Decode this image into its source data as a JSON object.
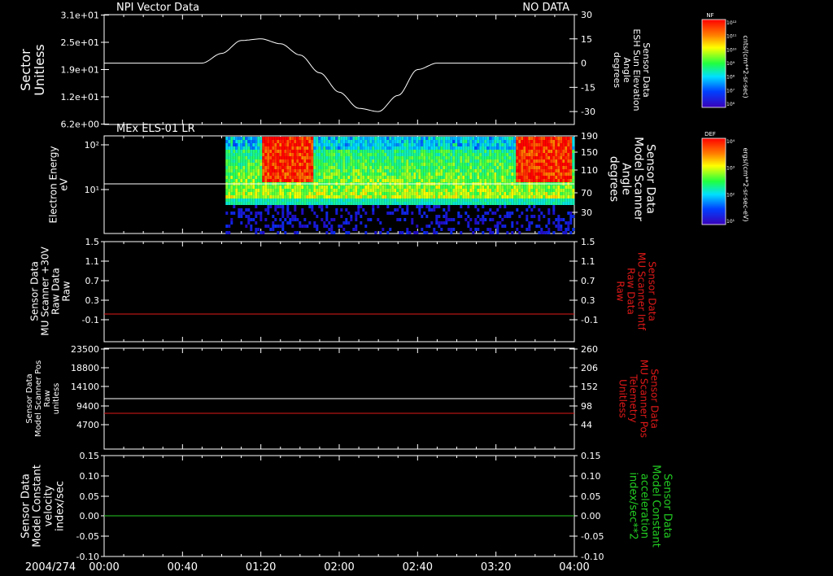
{
  "date_label": "2004/274",
  "x_ticks": [
    "00:00",
    "00:40",
    "01:20",
    "02:00",
    "02:40",
    "03:20",
    "04:00"
  ],
  "panels": [
    {
      "title": "NPI Vector Data",
      "status": "NO DATA",
      "left_label": [
        "Sector",
        "Unitless"
      ],
      "left_ticks": [
        "3.1e+01",
        "2.5e+01",
        "1.9e+01",
        "1.2e+01",
        "6.2e+00"
      ],
      "right_label": [
        "Sensor Data",
        "ESH Sun Elevation",
        "Angle",
        "degrees"
      ],
      "right_ticks": [
        "30",
        "15",
        "0",
        "-15",
        "-30"
      ],
      "colorbar": {
        "title": "NF",
        "ticks": [
          "10¹²",
          "10¹¹",
          "10¹⁰",
          "10⁹",
          "10⁸",
          "10⁷",
          "10⁶"
        ],
        "unit": "cnts/(cm**2-sr-sec)"
      }
    },
    {
      "title": "MEx ELS-01 LR",
      "left_label": [
        "Electron Energy",
        "eV"
      ],
      "left_ticks": [
        "10²",
        "10¹"
      ],
      "right_label": [
        "Sensor Data",
        "Model Scanner",
        "Angle",
        "degrees"
      ],
      "right_ticks": [
        "190",
        "150",
        "110",
        "70",
        "30"
      ],
      "colorbar": {
        "title": "DEF",
        "ticks": [
          "10⁴",
          "10³",
          "10²",
          "10¹"
        ],
        "unit": "ergs/(cm**2-sr-sec-eV)"
      }
    },
    {
      "left_label": [
        "Sensor Data",
        "MU Scanner +30V",
        "Raw Data",
        "Raw"
      ],
      "left_ticks": [
        "1.5",
        "1.1",
        "0.7",
        "0.3",
        "-0.1"
      ],
      "right_label": [
        "Sensor Data",
        "MU Scanner Intf",
        "Raw Data",
        "Raw"
      ],
      "right_ticks": [
        "1.5",
        "1.1",
        "0.7",
        "0.3",
        "-0.1"
      ]
    },
    {
      "left_label": [
        "Sensor Data",
        "Model Scanner Pos",
        "Raw",
        "unitless"
      ],
      "left_ticks": [
        "23500",
        "18800",
        "14100",
        "9400",
        "4700"
      ],
      "right_label": [
        "Sensor Data",
        "MU Scanner Pos",
        "Telemetry",
        "Unitless"
      ],
      "right_ticks": [
        "260",
        "206",
        "152",
        "98",
        "44"
      ]
    },
    {
      "left_label": [
        "Sensor Data",
        "Model Constant",
        "velocity",
        "index/sec"
      ],
      "left_ticks": [
        "0.15",
        "0.10",
        "0.05",
        "0.00",
        "-0.05",
        "-0.10"
      ],
      "right_label": [
        "Sensor Data",
        "Model Constant",
        "acceleration",
        "index/sec**2"
      ],
      "right_ticks": [
        "0.15",
        "0.10",
        "0.05",
        "0.00",
        "-0.05",
        "-0.10"
      ]
    }
  ],
  "colors": {
    "axis": "#ffffff",
    "red_trace": "#e01818",
    "green_trace": "#22cc22",
    "white_trace": "#ffffff"
  },
  "chart_data": [
    {
      "type": "line",
      "name": "Sun Elevation Angle",
      "x_minutes": [
        0,
        50,
        60,
        70,
        80,
        90,
        100,
        110,
        120,
        130,
        140,
        150,
        160,
        170,
        180,
        190,
        200,
        240
      ],
      "y_degrees": [
        0,
        0,
        6,
        14,
        15,
        12,
        5,
        -6,
        -18,
        -28,
        -30,
        -20,
        -4,
        0,
        0,
        0,
        0,
        0
      ],
      "ylim": [
        -38,
        30
      ],
      "xlim": [
        0,
        240
      ]
    },
    {
      "type": "heatmap",
      "name": "MEx ELS-01 LR",
      "data_start_minutes": 62,
      "xlim": [
        0,
        240
      ],
      "high_flux_intervals_minutes": [
        [
          80,
          106
        ],
        [
          210,
          238
        ]
      ],
      "white_line_energy_eV": 14
    },
    {
      "type": "line",
      "name": "MU Scanner +30V Raw",
      "x_minutes": [
        0,
        240
      ],
      "y": [
        0,
        0
      ],
      "ylim": [
        -0.3,
        1.5
      ]
    },
    {
      "type": "line",
      "series": [
        {
          "name": "Model Scanner Pos Raw",
          "x_minutes": [
            0,
            240
          ],
          "y": [
            11300,
            11300
          ],
          "color": "white"
        },
        {
          "name": "MU Scanner Pos Telemetry",
          "x_minutes": [
            0,
            240
          ],
          "y": [
            8300,
            8300
          ],
          "color": "red"
        }
      ],
      "ylim": [
        0,
        23500
      ]
    },
    {
      "type": "line",
      "name": "Model Constant velocity",
      "x_minutes": [
        0,
        240
      ],
      "y": [
        0,
        0
      ],
      "ylim": [
        -0.1,
        0.15
      ]
    }
  ]
}
